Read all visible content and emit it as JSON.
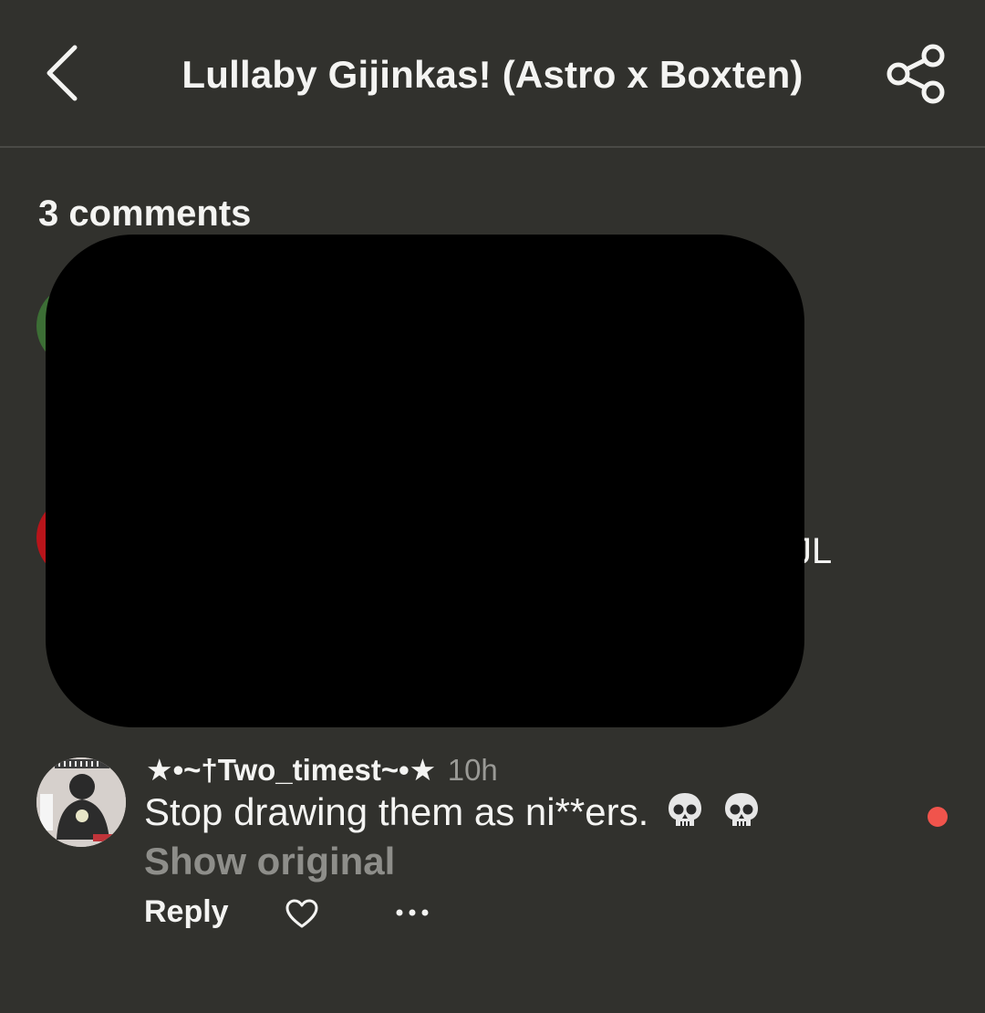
{
  "header": {
    "title": "Lullaby Gijinkas! (Astro x Boxten)",
    "back_icon": "chevron-left-icon",
    "share_icon": "share-icon"
  },
  "comments": {
    "count_label": "3 comments",
    "partial_text": "JL",
    "items": [
      {
        "username": "★•~†Two_timest~•★",
        "time": "10h",
        "text": "Stop drawing them as ni**ers.",
        "emoji": [
          "skull-icon",
          "skull-icon"
        ],
        "show_original": "Show original",
        "reply_label": "Reply",
        "like_icon": "heart-outline-icon",
        "more_icon": "more-horizontal-icon"
      }
    ]
  },
  "colors": {
    "background": "#31312d",
    "text": "#f4f4f2",
    "muted": "#8e8e8a",
    "unread_dot": "#f0544c",
    "redaction": "#000000"
  }
}
